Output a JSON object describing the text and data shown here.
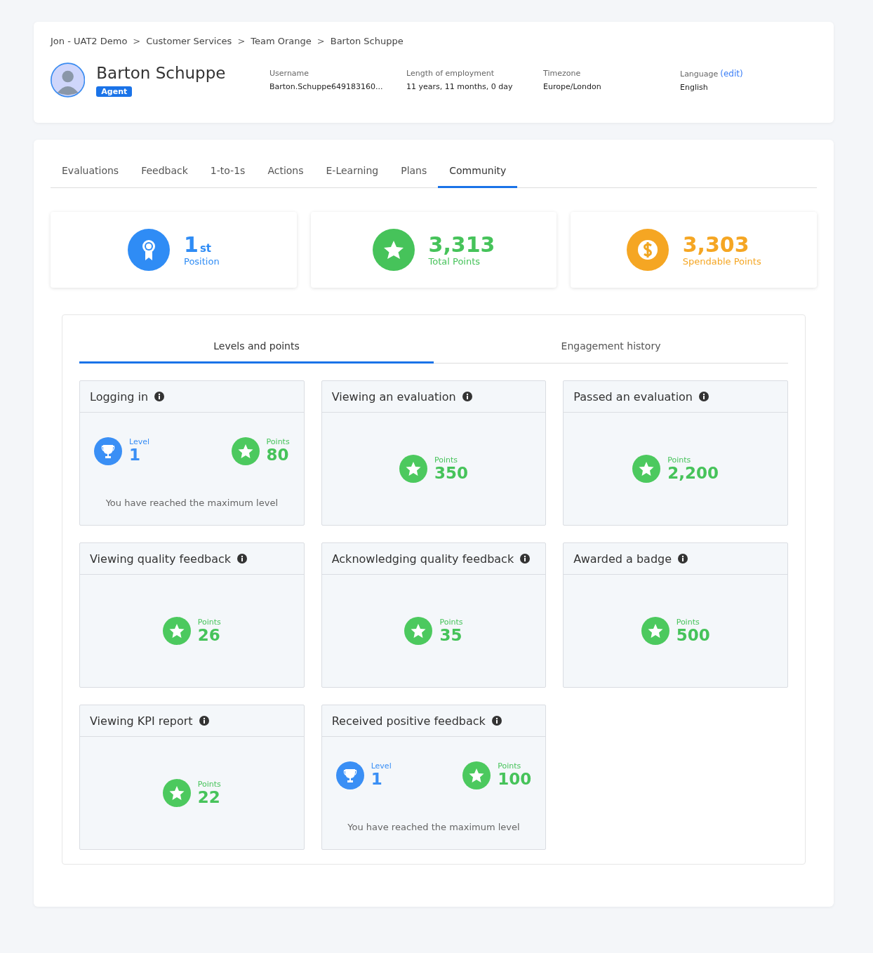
{
  "breadcrumb": [
    "Jon - UAT2 Demo",
    "Customer Services",
    "Team Orange",
    "Barton Schuppe"
  ],
  "breadcrumb_separator": ">",
  "profile": {
    "name": "Barton Schuppe",
    "role": "Agent",
    "fields": [
      {
        "label": "Username",
        "value": "Barton.Schuppe649183160..."
      },
      {
        "label": "Length of employment",
        "value": "11 years, 11 months, 0 day"
      },
      {
        "label": "Timezone",
        "value": "Europe/London"
      },
      {
        "label": "Language",
        "value": "English",
        "link": "(edit)"
      }
    ]
  },
  "tabs": [
    {
      "label": "Evaluations",
      "selected": false
    },
    {
      "label": "Feedback",
      "selected": false
    },
    {
      "label": "1-to-1s",
      "selected": false
    },
    {
      "label": "Actions",
      "selected": false
    },
    {
      "label": "E-Learning",
      "selected": false
    },
    {
      "label": "Plans",
      "selected": false
    },
    {
      "label": "Community",
      "selected": true
    }
  ],
  "stats": [
    {
      "kind": "position",
      "value": "1",
      "suffix": "st",
      "label": "Position",
      "color": "#2f8cf5"
    },
    {
      "kind": "star",
      "value": "3,313",
      "label": "Total Points",
      "color": "#46c35a"
    },
    {
      "kind": "coin",
      "value": "3,303",
      "label": "Spendable Points",
      "color": "#f5a623"
    }
  ],
  "subtabs": [
    {
      "label": "Levels and points",
      "selected": true
    },
    {
      "label": "Engagement history",
      "selected": false
    }
  ],
  "activities": [
    {
      "kind": "level",
      "title": "Logging in",
      "level_label": "Level",
      "level": "1",
      "points_label": "Points",
      "points": "80",
      "message": "You have reached the maximum level"
    },
    {
      "kind": "points",
      "title": "Viewing an evaluation",
      "points_label": "Points",
      "points": "350"
    },
    {
      "kind": "points",
      "title": "Passed an evaluation",
      "points_label": "Points",
      "points": "2,200"
    },
    {
      "kind": "points",
      "title": "Viewing quality feedback",
      "points_label": "Points",
      "points": "26"
    },
    {
      "kind": "points",
      "title": "Acknowledging quality feedback",
      "points_label": "Points",
      "points": "35"
    },
    {
      "kind": "points",
      "title": "Awarded a badge",
      "points_label": "Points",
      "points": "500"
    },
    {
      "kind": "points",
      "title": "Viewing KPI report",
      "points_label": "Points",
      "points": "22"
    },
    {
      "kind": "level",
      "title": "Received positive feedback",
      "level_label": "Level",
      "level": "1",
      "points_label": "Points",
      "points": "100",
      "message": "You have reached the maximum level"
    }
  ]
}
